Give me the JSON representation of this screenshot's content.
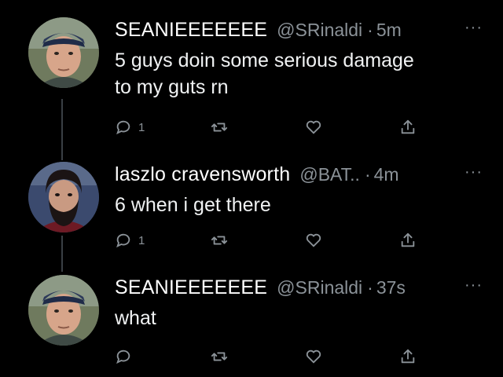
{
  "tweets": [
    {
      "display_name": "SEANIEEEEEEE",
      "handle": "@SRinaldi",
      "separator": "·",
      "time": "5m",
      "more": "···",
      "text_lines": [
        "5 guys doin some serious damage",
        "to my guts rn"
      ],
      "reply_count": "1",
      "avatar_icon": "bald-man-cap-avatar"
    },
    {
      "display_name": "laszlo cravensworth",
      "handle": "@BAT..",
      "separator": "·",
      "time": "4m",
      "more": "···",
      "text_lines": [
        "6 when i get there"
      ],
      "reply_count": "1",
      "avatar_icon": "bearded-man-avatar"
    },
    {
      "display_name": "SEANIEEEEEEE",
      "handle": "@SRinaldi",
      "separator": "·",
      "time": "37s",
      "more": "···",
      "text_lines": [
        "what"
      ],
      "reply_count": "",
      "avatar_icon": "bald-man-cap-avatar"
    }
  ],
  "icons": {
    "reply": "reply-icon",
    "retweet": "retweet-icon",
    "like": "heart-icon",
    "share": "share-icon"
  },
  "colors": {
    "background": "#000000",
    "primary_text": "#f0f2f3",
    "secondary_text": "#8b9298",
    "thread_line": "#3a3f44"
  }
}
